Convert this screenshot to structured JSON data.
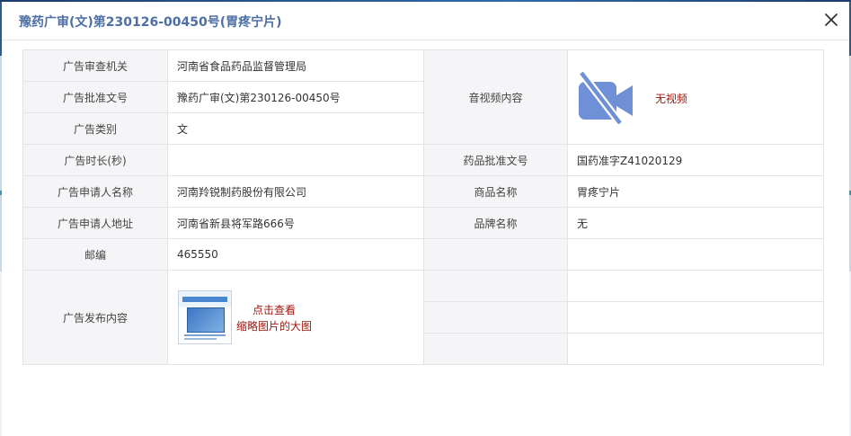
{
  "dialog": {
    "title": "豫药广审(文)第230126-00450号(胃疼宁片)"
  },
  "rows": {
    "review_agency": {
      "label": "广告审查机关",
      "value": "河南省食品药品监督管理局"
    },
    "approval_no": {
      "label": "广告批准文号",
      "value": "豫药广审(文)第230126-00450号"
    },
    "ad_category": {
      "label": "广告类别",
      "value": "文"
    },
    "ad_duration": {
      "label": "广告时长(秒)",
      "value": ""
    },
    "applicant_name": {
      "label": "广告申请人名称",
      "value": "河南羚锐制药股份有限公司"
    },
    "applicant_address": {
      "label": "广告申请人地址",
      "value": "河南省新县将军路666号"
    },
    "postcode": {
      "label": "邮编",
      "value": "465550"
    },
    "publish_content": {
      "label": "广告发布内容",
      "link_line1": "点击查看",
      "link_line2": "缩略图片的大图"
    },
    "av_content": {
      "label": "音视频内容",
      "no_video": "无视频"
    },
    "drug_approval_no": {
      "label": "药品批准文号",
      "value": "国药准字Z41020129"
    },
    "product_name": {
      "label": "商品名称",
      "value": "胃疼宁片"
    },
    "brand_name": {
      "label": "品牌名称",
      "value": "无"
    }
  },
  "icons": {
    "close": "close-icon",
    "video": "video-off-icon"
  },
  "colors": {
    "title": "#4d6fa6",
    "label_bg": "#f5f5f7",
    "link_red": "#a2160f",
    "video_icon": "#6f8fd6"
  }
}
